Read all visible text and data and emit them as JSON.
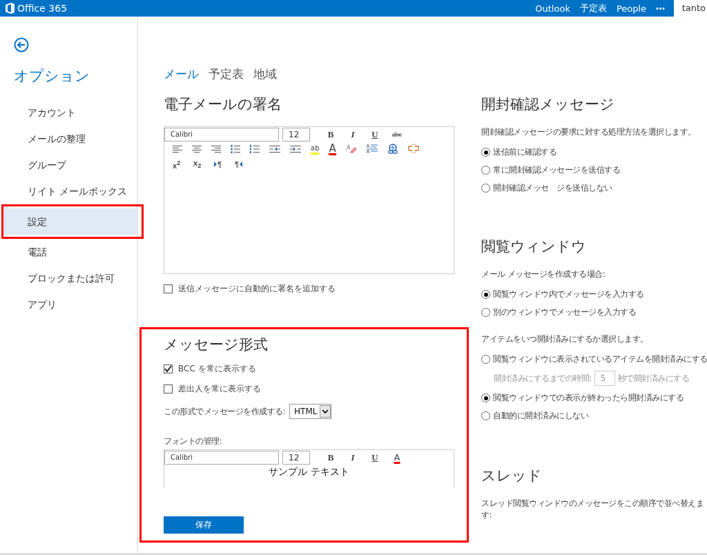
{
  "topbar": {
    "brand": "Office 365",
    "links": [
      {
        "label": "Outlook"
      },
      {
        "label": "予定表"
      },
      {
        "label": "People"
      }
    ],
    "more": "•••",
    "user": "tanto"
  },
  "sidebar": {
    "title": "オプション",
    "items": [
      {
        "label": "アカウント",
        "selected": false,
        "highlighted": false
      },
      {
        "label": "メールの整理",
        "selected": false,
        "highlighted": false
      },
      {
        "label": "グループ",
        "selected": false,
        "highlighted": false
      },
      {
        "label": "リイト メールボックス",
        "selected": false,
        "highlighted": false
      },
      {
        "label": "設定",
        "selected": true,
        "highlighted": true
      },
      {
        "label": "電話",
        "selected": false,
        "highlighted": false
      },
      {
        "label": "ブロックまたは許可",
        "selected": false,
        "highlighted": false
      },
      {
        "label": "アプリ",
        "selected": false,
        "highlighted": false
      }
    ]
  },
  "tabs": [
    {
      "label": "メール",
      "selected": true
    },
    {
      "label": "予定表",
      "selected": false
    },
    {
      "label": "地域",
      "selected": false
    }
  ],
  "signature": {
    "title": "電子メールの署名",
    "font": "Calibri",
    "size": "12",
    "format_buttons": [
      {
        "kind": "bold",
        "label": "B"
      },
      {
        "kind": "italic",
        "label": "I"
      },
      {
        "kind": "underline",
        "label": "U"
      },
      {
        "kind": "strike",
        "label": "abc"
      }
    ],
    "toolbar_row_2": [
      {
        "kind": "align-left"
      },
      {
        "kind": "align-center"
      },
      {
        "kind": "align-right"
      },
      {
        "kind": "bullets"
      },
      {
        "kind": "numbering"
      },
      {
        "kind": "outdent"
      },
      {
        "kind": "indent"
      },
      {
        "kind": "highlight",
        "label": "ab"
      },
      {
        "kind": "font-color",
        "label": "A"
      },
      {
        "kind": "eraser"
      },
      {
        "kind": "style"
      },
      {
        "kind": "link"
      },
      {
        "kind": "unlink"
      }
    ],
    "toolbar_row_3": [
      {
        "kind": "superscript",
        "label": "x$^{2}$"
      },
      {
        "kind": "subscript",
        "label": "x$_{2}$"
      },
      {
        "kind": "ltr",
        "label": "¶"
      },
      {
        "kind": "rtl",
        "label": "¶"
      }
    ],
    "auto_add": {
      "label": "送信メッセージに自動的に署名を追加する",
      "checked": false
    }
  },
  "message_format": {
    "title": "メッセージ形式",
    "highlighted": true,
    "options": [
      {
        "label": "BCC を常に表示する",
        "checked": true
      },
      {
        "label": "差出人を常に表示する",
        "checked": false
      }
    ],
    "compose_label": "この形式でメッセージを作成する:",
    "compose_value": "HTML",
    "font_label": "フォントの管理:",
    "font": "Calibri",
    "size": "12",
    "format_buttons": [
      {
        "kind": "bold",
        "label": "B"
      },
      {
        "kind": "italic",
        "label": "I"
      },
      {
        "kind": "underline",
        "label": "U"
      },
      {
        "kind": "font-color",
        "label": "A"
      }
    ],
    "sample": "サンプル テキスト",
    "save": "保存"
  },
  "read_receipts": {
    "title": "開封確認メッセージ",
    "description": "開封確認メッセージの要求に対する処理方法を選択します。",
    "options": [
      {
        "label": "送信前に確認する",
        "selected": true
      },
      {
        "label": "常に開封確認メッセージを送信する",
        "selected": false
      },
      {
        "label": "開封確認メッセ　ジを送信しない",
        "selected": false
      }
    ]
  },
  "reading_pane": {
    "title": "閲覧ウィンドウ",
    "compose_description": "メール メッセージを作成する場合:",
    "compose_options": [
      {
        "label": "閲覧ウィンドウ内でメッセージを入力する",
        "selected": true
      },
      {
        "label": "別のウィンドウでメッセージを入力する",
        "selected": false
      }
    ],
    "mark_description": "アイテムをいつ開封済みにするか選択します。",
    "mark_options": [
      {
        "label": "閲覧ウィンドウに表示されているアイテムを開封済みにする",
        "selected": false
      },
      {
        "label": "閲覧ウィンドウでの表示が終わったら開封済みにする",
        "selected": true
      },
      {
        "label": "自動的に開封済みにしない",
        "selected": false
      }
    ],
    "delay": {
      "label": "開封済みにするまでの時間:",
      "value": "5",
      "suffix": "秒で開封済みにする",
      "disabled": true
    }
  },
  "threads": {
    "title": "スレッド",
    "description": "スレッド閲覧ウィンドウのメッセージをこの順序で並べ替えます:"
  }
}
